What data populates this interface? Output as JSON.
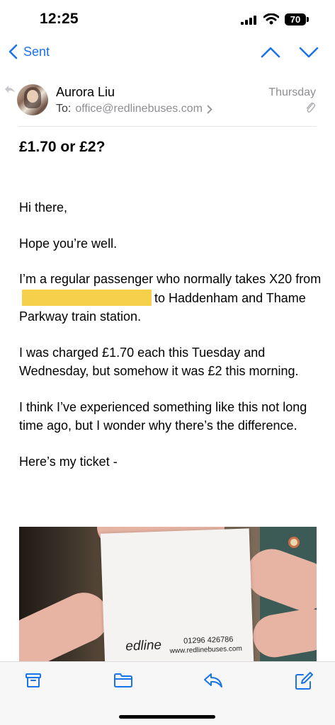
{
  "status": {
    "time": "12:25",
    "battery": "70"
  },
  "nav": {
    "back_label": "Sent"
  },
  "email": {
    "sender": "Aurora Liu",
    "to_label": "To:",
    "to_address": "office@redlinebuses.com",
    "date": "Thursday",
    "subject": "£1.70 or £2?",
    "greeting": "Hi there,",
    "p1": "Hope you’re well.",
    "p2_before": "I’m a regular passenger who normally takes X20 from",
    "p2_after": "to Haddenham and Thame Parkway train station.",
    "p3": "I was charged £1.70 each this Tuesday and Wednesday, but somehow it was £2 this morning.",
    "p4": "I think I’ve experienced something like this not long time ago, but I wonder why there’s the difference.",
    "p5": "Here’s my ticket -",
    "attachment": {
      "logo_text": "edline",
      "phone": "01296 426786",
      "website": "www.redlinebuses.com"
    }
  },
  "toolbar": {
    "archive_icon": "archive-icon",
    "folder_icon": "folder-icon",
    "reply_icon": "reply-icon",
    "compose_icon": "compose-icon"
  },
  "colors": {
    "accent": "#1a73e8",
    "redaction": "#f6d04a",
    "secondary_text": "#8e8e93"
  }
}
